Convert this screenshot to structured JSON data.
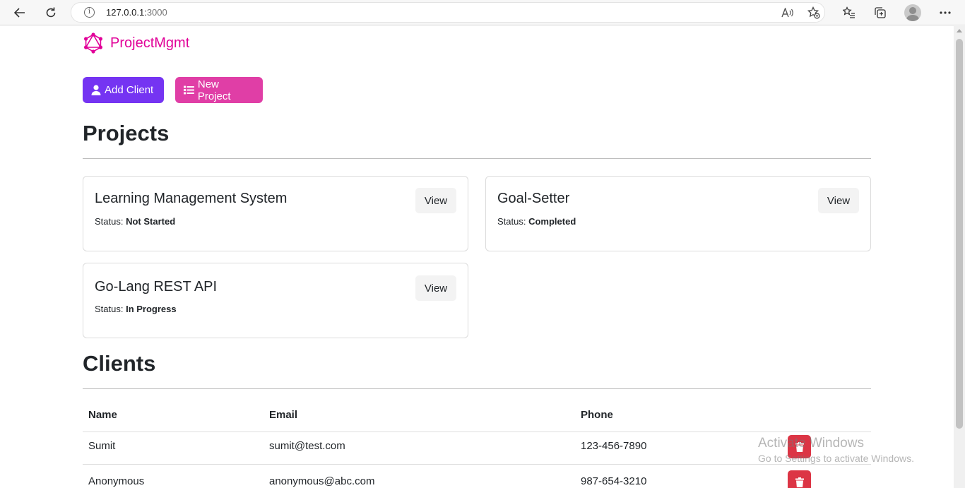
{
  "browser": {
    "url_host": "127.0.0.1:",
    "url_port": "3000",
    "info_icon": "i"
  },
  "brand": {
    "name": "ProjectMgmt",
    "color": "#e10098"
  },
  "actions": {
    "add_client_label": "Add Client",
    "new_project_label": "New Project",
    "add_client_color": "#7534f2",
    "new_project_color": "#e03ea6"
  },
  "projects": {
    "heading": "Projects",
    "items": [
      {
        "name": "Learning Management System",
        "status_label": "Status:",
        "status": "Not Started",
        "view_label": "View"
      },
      {
        "name": "Goal-Setter",
        "status_label": "Status:",
        "status": "Completed",
        "view_label": "View"
      },
      {
        "name": "Go-Lang REST API",
        "status_label": "Status:",
        "status": "In Progress",
        "view_label": "View"
      }
    ]
  },
  "clients": {
    "heading": "Clients",
    "columns": [
      "Name",
      "Email",
      "Phone"
    ],
    "rows": [
      {
        "name": "Sumit",
        "email": "sumit@test.com",
        "phone": "123-456-7890"
      },
      {
        "name": "Anonymous",
        "email": "anonymous@abc.com",
        "phone": "987-654-3210"
      }
    ],
    "delete_color": "#dc3545"
  },
  "watermark": {
    "line1": "Activate Windows",
    "line2": "Go to Settings to activate Windows."
  }
}
